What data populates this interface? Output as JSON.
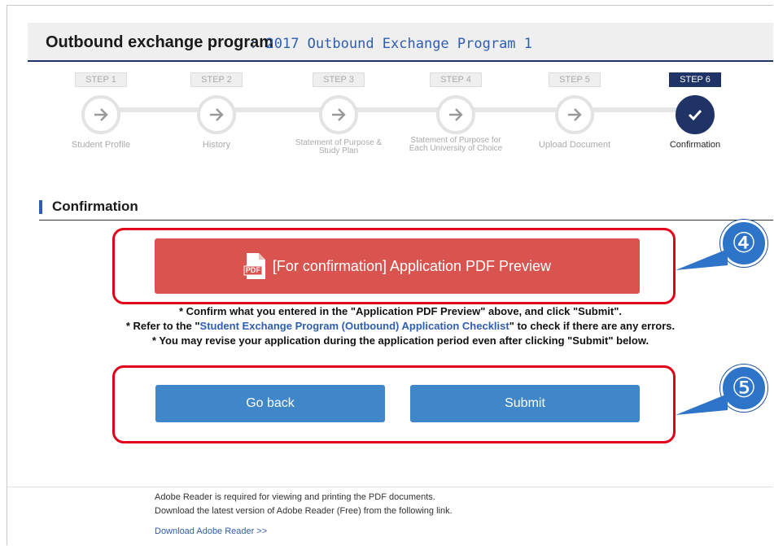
{
  "header": {
    "title": "Outbound exchange program",
    "separator": ":",
    "subtitle": "2017 Outbound Exchange Program 1"
  },
  "steps": [
    {
      "pill": "STEP 1",
      "label": "Student Profile",
      "state": "done"
    },
    {
      "pill": "STEP 2",
      "label": "History",
      "state": "done"
    },
    {
      "pill": "STEP 3",
      "label": "Statement of Purpose & Study Plan",
      "state": "done"
    },
    {
      "pill": "STEP 4",
      "label": "Statement of Purpose for Each University of Choice",
      "state": "done"
    },
    {
      "pill": "STEP 5",
      "label": "Upload Document",
      "state": "done"
    },
    {
      "pill": "STEP 6",
      "label": "Confirmation",
      "state": "active"
    }
  ],
  "section": {
    "title": "Confirmation"
  },
  "pdf_button": {
    "label": "[For confirmation] Application PDF Preview",
    "icon": "pdf-icon",
    "icon_text": "PDF"
  },
  "notes": {
    "line1": "* Confirm what you entered in the \"Application PDF Preview\" above, and click \"Submit\".",
    "line2_pre": "* Refer to the \"",
    "line2_link": "Student Exchange Program (Outbound) Application Checklist",
    "line2_post": "\" to check if there are any errors.",
    "line3": "* You may revise your application during the application period even after clicking \"Submit\" below."
  },
  "buttons": {
    "back": "Go back",
    "submit": "Submit"
  },
  "callouts": {
    "four": "④",
    "five": "⑤"
  },
  "footer": {
    "line1": "Adobe Reader is required for viewing and printing the PDF documents.",
    "line2": "Download the latest version of Adobe Reader (Free) from the following link.",
    "link": "Download Adobe Reader >>"
  },
  "colors": {
    "navy": "#1f3366",
    "red_button": "#d9534f",
    "blue_button": "#3f87c9",
    "callout_frame": "#e0001a"
  }
}
